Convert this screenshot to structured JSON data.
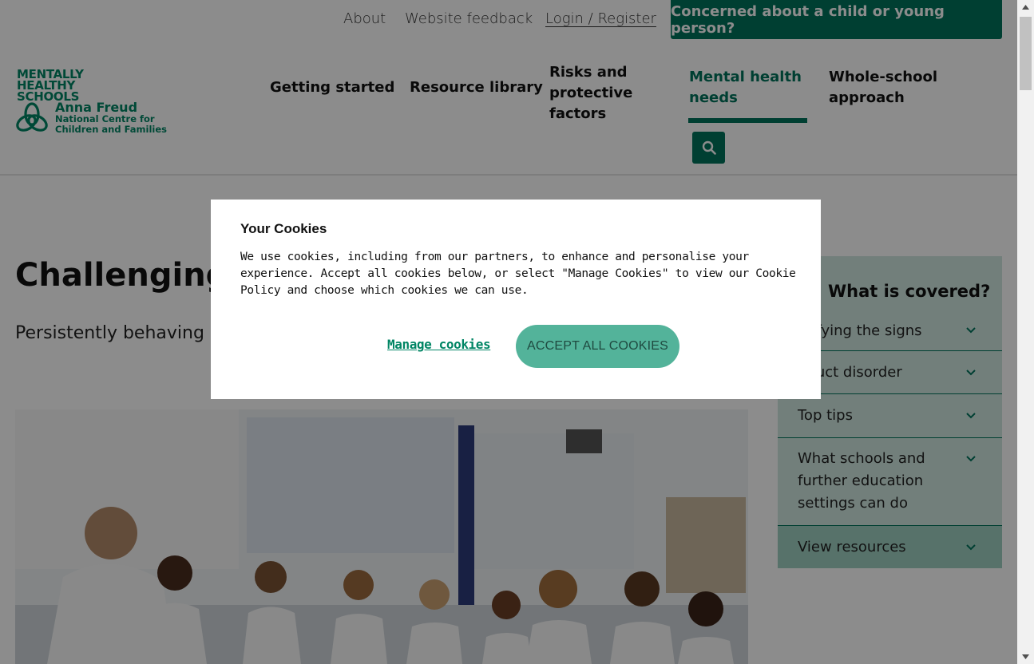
{
  "utility_nav": {
    "about": "About",
    "feedback": "Website feedback",
    "login": "Login / Register",
    "concern_button": "Concerned about a child or young person?"
  },
  "logo": {
    "mhs": "MENTALLY HEALTHY SCHOOLS",
    "org": "Anna Freud",
    "subtitle": "National Centre for Children and Families"
  },
  "main_nav": {
    "getting_started": "Getting started",
    "resource_library": "Resource library",
    "risks": "Risks and protective factors",
    "mental_health": "Mental health needs",
    "whole_school": "Whole-school approach",
    "active_item": "Mental health needs"
  },
  "hero": {
    "title": "Challenging",
    "lede": "Persistently behaving people communicate t distress."
  },
  "toc": {
    "title": "What is covered?",
    "items": [
      {
        "label": "ntifying the signs"
      },
      {
        "label": "nduct disorder"
      },
      {
        "label": "Top tips"
      },
      {
        "label": "What schools and further education settings can do"
      },
      {
        "label": "View resources"
      }
    ]
  },
  "cookie_modal": {
    "title": "Your Cookies",
    "body": "We use cookies, including from our partners, to enhance and personalise your experience. Accept all cookies below, or select \"Manage Cookies\" to view our Cookie Policy and choose which cookies we can use.",
    "manage_label": "Manage cookies",
    "accept_label": "ACCEPT ALL COOKIES"
  },
  "colors": {
    "brand_green": "#00735c",
    "accept_button": "#53b39a",
    "toc_background": "#cfe8e1"
  },
  "icons": [
    "search-icon",
    "chevron-down-icon",
    "scroll-up-arrow-icon",
    "scroll-down-arrow-icon"
  ]
}
